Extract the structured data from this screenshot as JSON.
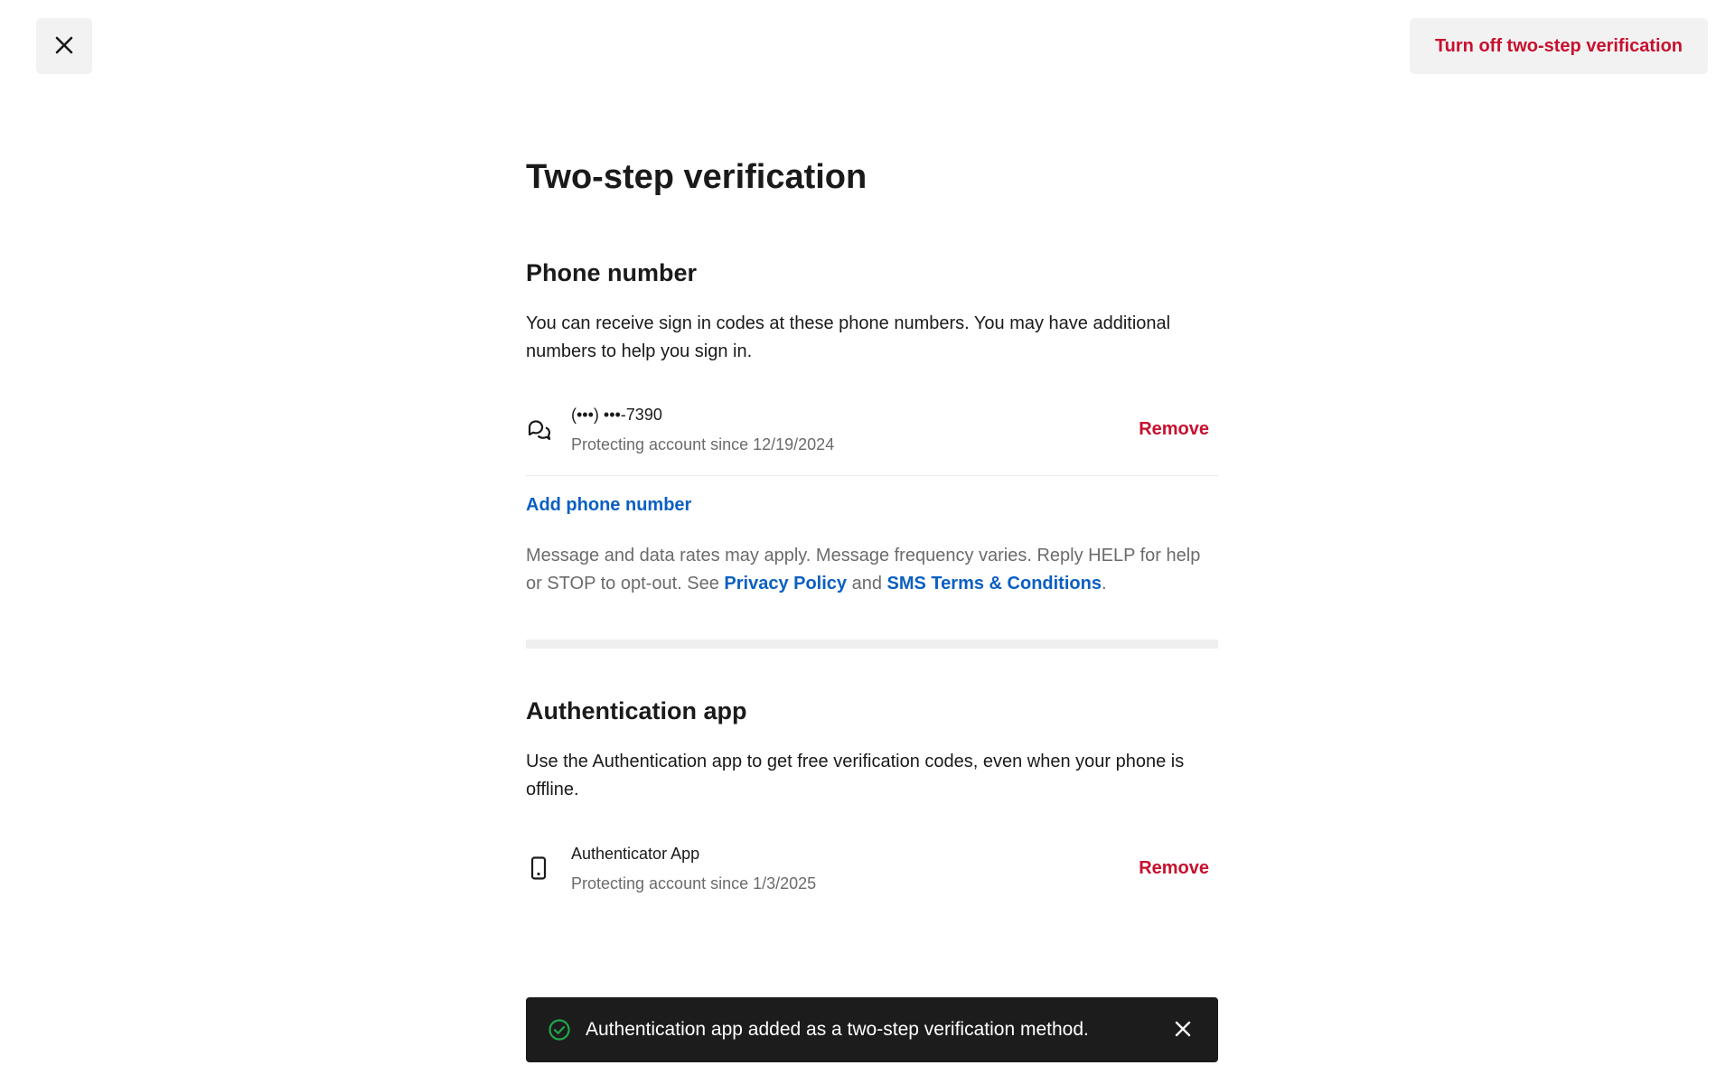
{
  "header": {
    "close_icon": "close-icon",
    "turn_off_label": "Turn off two-step verification"
  },
  "page": {
    "title": "Two-step verification"
  },
  "phone_section": {
    "title": "Phone number",
    "description": "You can receive sign in codes at these phone numbers. You may have additional numbers to help you sign in.",
    "methods": [
      {
        "icon": "chat-bubbles-icon",
        "name": "(•••) •••-7390",
        "since": "Protecting account since 12/19/2024",
        "remove_label": "Remove"
      }
    ],
    "add_label": "Add phone number",
    "legal": {
      "text_before": "Message and data rates may apply. Message frequency varies. Reply HELP for help or STOP to opt-out. See ",
      "privacy_link": "Privacy Policy",
      "text_middle": " and ",
      "sms_terms_link": "SMS Terms & Conditions",
      "text_after": "."
    }
  },
  "auth_section": {
    "title": "Authentication app",
    "description": "Use the Authentication app to get free verification codes, even when your phone is offline.",
    "methods": [
      {
        "icon": "smartphone-icon",
        "name": "Authenticator App",
        "since": "Protecting account since 1/3/2025",
        "remove_label": "Remove"
      }
    ]
  },
  "toast": {
    "icon": "check-circle-icon",
    "message": "Authentication app added as a two-step verification method.",
    "close_icon": "close-icon"
  },
  "colors": {
    "danger": "#c8102e",
    "link": "#0a5fc2",
    "success": "#1fa64a",
    "toast_bg": "#1c1c1c"
  }
}
